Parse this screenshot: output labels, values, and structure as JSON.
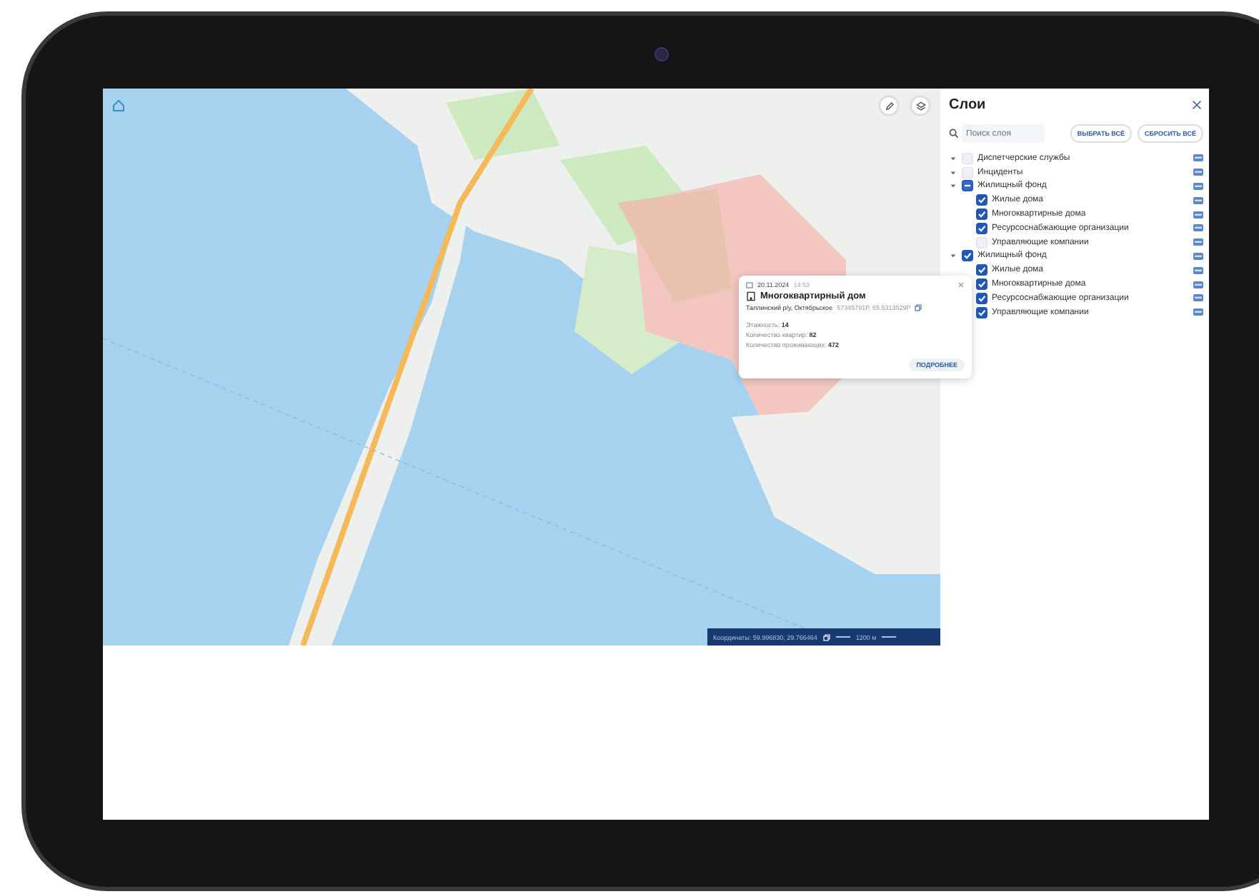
{
  "map": {
    "coordinates_label": "Координаты:",
    "coordinates": "59.996830, 29.766464",
    "scale": "1200 м"
  },
  "popup": {
    "date": "20.11.2024",
    "time": "14:53",
    "title": "Многоквартирный дом",
    "address": "Таллинский р/у, Октябрьское",
    "geo": "57345791P, 65.5313529P",
    "fields": [
      {
        "label": "Этажность:",
        "value": "14"
      },
      {
        "label": "Количество квартир:",
        "value": "82"
      },
      {
        "label": "Количество проживающих:",
        "value": "472"
      }
    ],
    "button": "ПОДРОБНЕЕ"
  },
  "layers": {
    "title": "Слои",
    "search": {
      "placeholder": "Поиск слоя"
    },
    "buttons": [
      "ВЫБРАТЬ ВСЁ",
      "СБРОСИТЬ ВСЁ"
    ],
    "items": [
      {
        "label": "Диспетчерские службы",
        "checked": false,
        "indeterminate": false,
        "expanded": true
      },
      {
        "label": "Инциденты",
        "checked": false,
        "indeterminate": false,
        "expanded": true
      },
      {
        "label": "Жилищный фонд",
        "checked": false,
        "indeterminate": true,
        "expanded": true,
        "children": [
          {
            "label": "Жилые дома",
            "checked": true
          },
          {
            "label": "Многоквартирные дома",
            "checked": true
          },
          {
            "label": "Ресурсоснабжающие организации",
            "checked": true
          },
          {
            "label": "Управляющие компании",
            "checked": false
          }
        ]
      },
      {
        "label": "Жилищный фонд",
        "checked": true,
        "indeterminate": false,
        "expanded": true,
        "children": [
          {
            "label": "Жилые дома",
            "checked": true
          },
          {
            "label": "Многоквартирные дома",
            "checked": true
          },
          {
            "label": "Ресурсоснабжающие организации",
            "checked": true
          },
          {
            "label": "Управляющие компании",
            "checked": true
          }
        ]
      }
    ]
  }
}
